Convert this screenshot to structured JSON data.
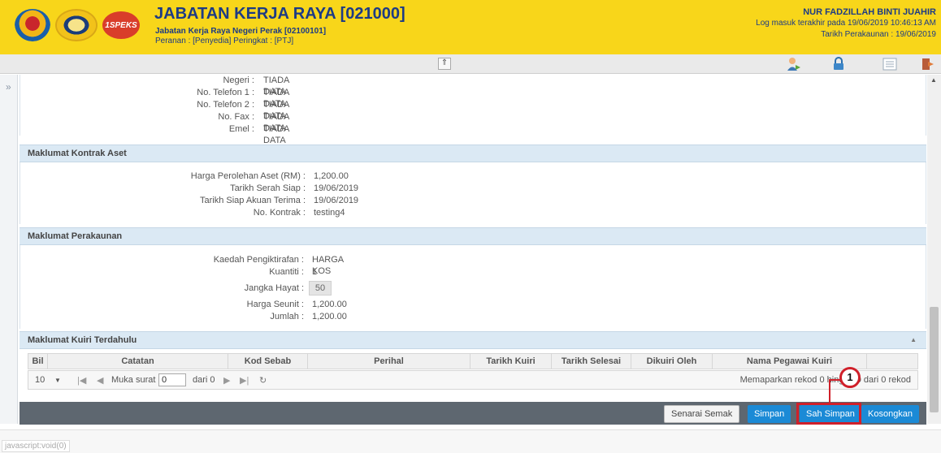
{
  "header": {
    "logo3_text": "1SPEKS",
    "title": "JABATAN KERJA RAYA [021000]",
    "subtitle": "Jabatan Kerja Raya Negeri Perak [02100101]",
    "role": "Peranan : [Penyedia] Peringkat : [PTJ]",
    "user_name": "NUR FADZILLAH BINTI JUAHIR",
    "last_login": "Log masuk terakhir pada 19/06/2019 10:46:13 AM",
    "account_date": "Tarikh Perakaunan : 19/06/2019"
  },
  "toolbar": {
    "collapse_symbol": "⇑"
  },
  "leftbar": {
    "expand_symbol": "»"
  },
  "contact": [
    {
      "label": "Negeri :",
      "value": "TIADA DATA"
    },
    {
      "label": "No. Telefon 1 :",
      "value": "TIADA DATA"
    },
    {
      "label": "No. Telefon 2 :",
      "value": "TIADA DATA"
    },
    {
      "label": "No. Fax :",
      "value": "TIADA DATA"
    },
    {
      "label": "Emel :",
      "value": "TIADA DATA"
    }
  ],
  "kontrak": {
    "title": "Maklumat Kontrak Aset",
    "rows": [
      {
        "label": "Harga Perolehan Aset (RM) :",
        "value": "1,200.00"
      },
      {
        "label": "Tarikh Serah Siap :",
        "value": "19/06/2019"
      },
      {
        "label": "Tarikh Siap Akuan Terima :",
        "value": "19/06/2019"
      },
      {
        "label": "No. Kontrak :",
        "value": "testing4"
      }
    ]
  },
  "perakaunan": {
    "title": "Maklumat Perakaunan",
    "kaedah_label": "Kaedah Pengiktirafan :",
    "kaedah_value": "HARGA KOS",
    "kuantiti_label": "Kuantiti :",
    "kuantiti_value": "1",
    "hayat_label": "Jangka Hayat :",
    "hayat_value": "50",
    "seunit_label": "Harga Seunit :",
    "seunit_value": "1,200.00",
    "jumlah_label": "Jumlah :",
    "jumlah_value": "1,200.00"
  },
  "kuiri": {
    "title": "Maklumat Kuiri Terdahulu",
    "columns": [
      "Bil",
      "Catatan",
      "Kod Sebab",
      "Perihal",
      "Tarikh Kuiri",
      "Tarikh Selesai",
      "Dikuiri Oleh",
      "Nama Pegawai Kuiri"
    ],
    "pager": {
      "page_size": "10",
      "page_label": "Muka surat",
      "page_value": "0",
      "of_label": "dari 0",
      "summary": "Memaparkan rekod 0 hingga 0 dari 0 rekod"
    }
  },
  "actions": {
    "semak": "Senarai Semak",
    "simpan": "Simpan",
    "sah_simpan": "Sah Simpan",
    "kosongkan": "Kosongkan"
  },
  "annotation": {
    "number": "1"
  },
  "statusbar": {
    "text": "javascript:void(0)"
  },
  "colors": {
    "header_bg": "#f8d61a",
    "title_blue": "#1d3b85",
    "button_blue": "#1b8ad6",
    "highlight_red": "#d0202a"
  }
}
